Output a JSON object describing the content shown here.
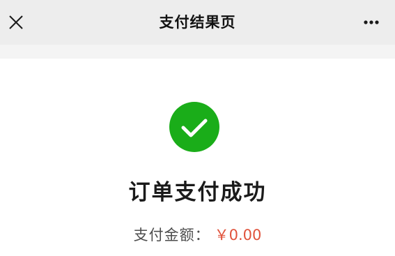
{
  "nav": {
    "title": "支付结果页",
    "close_icon": "close-icon",
    "more_icon": "more-icon",
    "background": "#ededed"
  },
  "result": {
    "status_icon": "check-circle-icon",
    "status_color": "#1aad19",
    "title": "订单支付成功",
    "amount_label": "支付金额：",
    "amount_value": "￥0.00",
    "amount_color": "#e0533c"
  }
}
